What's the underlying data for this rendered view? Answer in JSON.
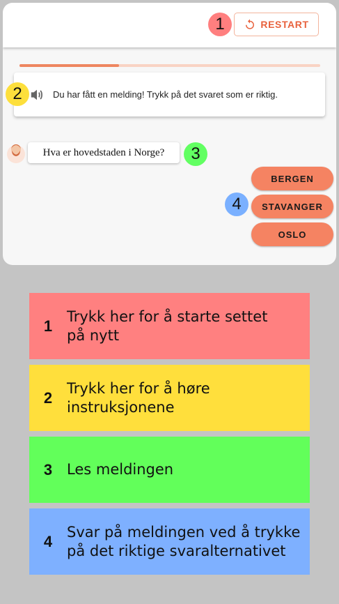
{
  "header": {
    "restart_label": "RESTART",
    "restart_icon": "restart-icon",
    "accent_color": "#e8623d"
  },
  "progress": {
    "fraction": 0.33,
    "fill_color": "#ee8660",
    "track_color": "#f9d3c4"
  },
  "instruction": {
    "text": "Du har fått en melding! Trykk på det svaret som er riktig.",
    "icon": "speaker-icon"
  },
  "message": {
    "text": "Hva er hovedstaden i Norge?",
    "avatar": "person-avatar"
  },
  "answers": [
    {
      "label": "BERGEN"
    },
    {
      "label": "STAVANGER"
    },
    {
      "label": "OSLO"
    }
  ],
  "answer_color": "#f58362",
  "badges": [
    {
      "number": "1",
      "color": "#ff7f7f"
    },
    {
      "number": "2",
      "color": "#fddf3c"
    },
    {
      "number": "3",
      "color": "#62ff62"
    },
    {
      "number": "4",
      "color": "#7ab0ff"
    }
  ],
  "legend": [
    {
      "number": "1",
      "line1": "Trykk her for å starte settet",
      "line2": "på nytt",
      "color": "#ff8080"
    },
    {
      "number": "2",
      "line1": "Trykk her for å høre",
      "line2": "instruksjonene",
      "color": "#ffdf3c"
    },
    {
      "number": "3",
      "line1": "Les meldingen",
      "line2": "",
      "color": "#62ff5a"
    },
    {
      "number": "4",
      "line1": "Svar på meldingen ved å trykke",
      "line2": "på det riktige svaralternativet",
      "color": "#7eb0ff"
    }
  ]
}
